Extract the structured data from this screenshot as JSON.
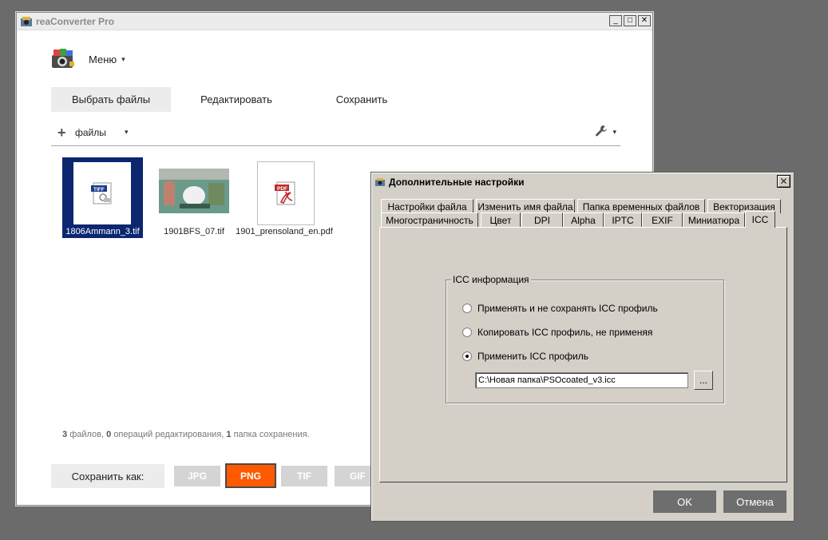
{
  "window": {
    "title": "reaConverter Pro",
    "minimize": "_",
    "maximize": "□",
    "close": "✕"
  },
  "menu": {
    "label": "Меню",
    "caret": "▾"
  },
  "tabs": [
    {
      "label": "Выбрать файлы"
    },
    {
      "label": "Редактировать"
    },
    {
      "label": "Сохранить"
    }
  ],
  "files_toolbar": {
    "plus": "+",
    "label": "файлы",
    "caret": "▾",
    "tools_caret": "▾"
  },
  "files": [
    {
      "name": "1806Ammann_3.tif",
      "badge": "TIFF"
    },
    {
      "name": "1901BFS_07.tif"
    },
    {
      "name": "1901_prensoland_en.pdf",
      "badge": "PDF"
    }
  ],
  "summary": {
    "files_count": "3",
    "files_text": "файлов,",
    "ops_count": "0",
    "ops_text": "операций редактирования,",
    "folders_count": "1",
    "folders_text": "папка сохранения."
  },
  "save_as": {
    "label": "Сохранить как:"
  },
  "formats": [
    "JPG",
    "PNG",
    "TIF",
    "GIF"
  ],
  "selected_format": "PNG",
  "colors": {
    "accent": "#ff5a00",
    "selection": "#0c2670",
    "dialog_bg": "#d4d0c8"
  },
  "dialog": {
    "title": "Дополнительные настройки",
    "close": "✕",
    "tabs_row1": [
      "Настройки файла",
      "Изменить имя файла",
      "Папка временных файлов",
      "Векторизация"
    ],
    "tabs_row2": [
      "Многостраничность",
      "Цвет",
      "DPI",
      "Alpha",
      "IPTC",
      "EXIF",
      "Миниатюра",
      "ICC"
    ],
    "active_tab": "ICC",
    "group_title": "ICC информация",
    "options": [
      {
        "label": "Применять и не сохранять ICC профиль",
        "selected": false
      },
      {
        "label": "Копировать ICC профиль, не применяя",
        "selected": false
      },
      {
        "label": "Применить ICC профиль",
        "selected": true
      }
    ],
    "path_value": "C:\\Новая папка\\PSOcoated_v3.icc",
    "browse_label": "...",
    "ok_label": "OK",
    "cancel_label": "Отмена"
  }
}
